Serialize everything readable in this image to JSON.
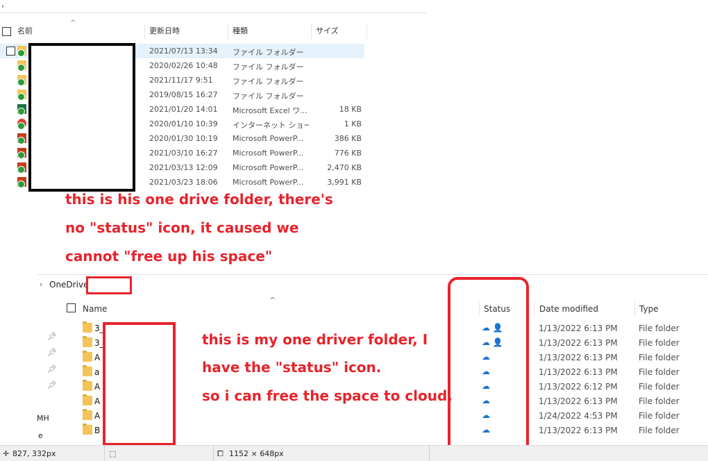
{
  "top_explorer": {
    "columns": {
      "name": "名前",
      "modified": "更新日時",
      "type": "種類",
      "size": "サイズ"
    },
    "rows": [
      {
        "date": "2021/07/13 13:34",
        "type": "ファイル フォルダー",
        "size": ""
      },
      {
        "date": "2020/02/26 10:48",
        "type": "ファイル フォルダー",
        "size": ""
      },
      {
        "date": "2021/11/17 9:51",
        "type": "ファイル フォルダー",
        "size": ""
      },
      {
        "date": "2019/08/15 16:27",
        "type": "ファイル フォルダー",
        "size": ""
      },
      {
        "date": "2021/01/20 14:01",
        "type": "Microsoft Excel ワ...",
        "size": "18 KB"
      },
      {
        "date": "2020/01/10 10:39",
        "type": "インターネット ショート...",
        "size": "1 KB"
      },
      {
        "date": "2020/01/30 10:19",
        "type": "Microsoft PowerP...",
        "size": "386 KB"
      },
      {
        "date": "2021/03/10 16:27",
        "type": "Microsoft PowerP...",
        "size": "776 KB"
      },
      {
        "date": "2021/03/13 12:09",
        "type": "Microsoft PowerP...",
        "size": "2,470 KB"
      },
      {
        "date": "2021/03/23 18:06",
        "type": "Microsoft PowerP...",
        "size": "3,991 KB"
      }
    ]
  },
  "annotation_top": {
    "line1": "this is his one drive folder, there's",
    "line2": "no \"status\" icon, it caused we",
    "line3": "cannot \"free up his space\""
  },
  "bottom_explorer": {
    "breadcrumb": "OneDrive",
    "columns": {
      "name": "Name",
      "status": "Status",
      "modified": "Date modified",
      "type": "Type"
    },
    "rows": [
      {
        "name": "3_",
        "status": "☁ 👤",
        "date": "1/13/2022 6:13 PM",
        "type": "File folder"
      },
      {
        "name": "3_",
        "status": "☁ 👤",
        "date": "1/13/2022 6:13 PM",
        "type": "File folder"
      },
      {
        "name": "A",
        "status": "☁",
        "date": "1/13/2022 6:13 PM",
        "type": "File folder"
      },
      {
        "name": "a",
        "status": "☁",
        "date": "1/13/2022 6:13 PM",
        "type": "File folder"
      },
      {
        "name": "A",
        "status": "☁",
        "date": "1/13/2022 6:12 PM",
        "type": "File folder"
      },
      {
        "name": "A",
        "status": "☁",
        "date": "1/13/2022 6:13 PM",
        "type": "File folder"
      },
      {
        "name": "A",
        "status": "☁",
        "date": "1/24/2022 4:53 PM",
        "type": "File folder"
      },
      {
        "name": "B",
        "status": "☁",
        "date": "1/13/2022 6:13 PM",
        "type": "File folder"
      }
    ],
    "left_labels": [
      "MH",
      "e"
    ]
  },
  "annotation_bottom": {
    "line1": "this is my one driver folder, I",
    "line2": "have the \"status\" icon.",
    "line3": "so i can free the space to cloud."
  },
  "statusbar": {
    "coords": "827, 332px",
    "size": "1152 × 648px"
  },
  "colors": {
    "annotation": "#e8232b",
    "accent_cloud": "#1a73c8",
    "selection": "#e5f1fb"
  }
}
